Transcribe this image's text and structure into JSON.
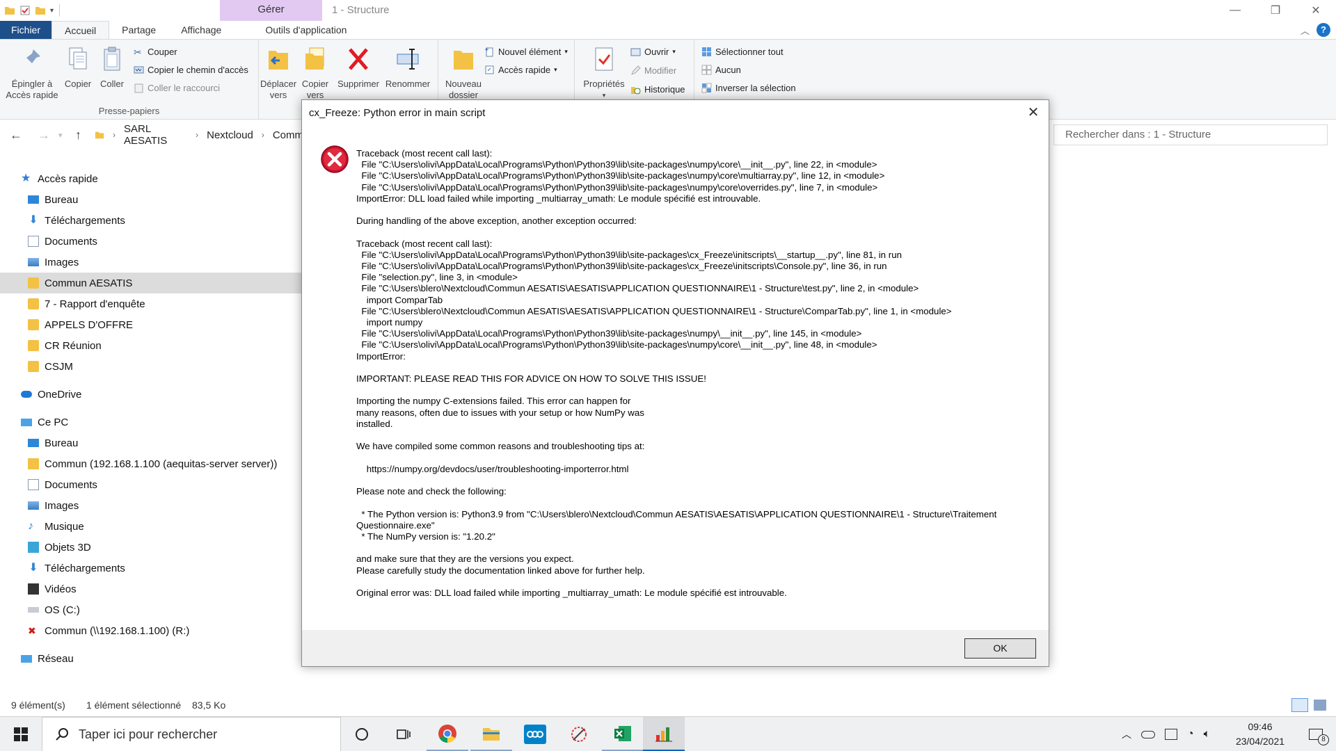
{
  "window": {
    "title": "1 - Structure",
    "context_tab": "Gérer"
  },
  "ribbon_tabs": [
    "Fichier",
    "Accueil",
    "Partage",
    "Affichage",
    "Outils d'application"
  ],
  "ribbon": {
    "pin_label": "Épingler à Accès rapide",
    "pin_line1": "Épingler à",
    "pin_line2": "Accès rapide",
    "copy": "Copier",
    "paste": "Coller",
    "cut": "Couper",
    "copy_path": "Copier le chemin d'accès",
    "paste_shortcut": "Coller le raccourci",
    "clipboard_group": "Presse-papiers",
    "move_line1": "Déplacer",
    "move_line2": "vers",
    "copyto_line1": "Copier",
    "copyto_line2": "vers",
    "delete": "Supprimer",
    "rename": "Renommer",
    "newfolder_line1": "Nouveau",
    "newfolder_line2": "dossier",
    "new_item": "Nouvel élément",
    "quick_access": "Accès rapide",
    "properties": "Propriétés",
    "open": "Ouvrir",
    "edit": "Modifier",
    "history": "Historique",
    "select_all": "Sélectionner tout",
    "select_none": "Aucun",
    "invert": "Inverser la sélection"
  },
  "address": {
    "crumbs": [
      "SARL AESATIS",
      "Nextcloud",
      "Comm"
    ],
    "search_placeholder": "Rechercher dans : 1 - Structure"
  },
  "nav": {
    "quick_access": "Accès rapide",
    "qa_items": [
      "Bureau",
      "Téléchargements",
      "Documents",
      "Images",
      "Commun AESATIS",
      "7 - Rapport d'enquête",
      "APPELS D'OFFRE",
      "CR Réunion",
      "CSJM"
    ],
    "onedrive": "OneDrive",
    "this_pc": "Ce PC",
    "pc_items": [
      "Bureau",
      "Commun (192.168.1.100 (aequitas-server server))",
      "Documents",
      "Images",
      "Musique",
      "Objets 3D",
      "Téléchargements",
      "Vidéos",
      "OS (C:)",
      "Commun (\\\\192.168.1.100) (R:)"
    ],
    "network": "Réseau"
  },
  "status": {
    "count": "9 élément(s)",
    "selected": "1 élément sélectionné",
    "size": "83,5 Ko"
  },
  "dialog": {
    "title": "cx_Freeze: Python error in main script",
    "message": "Traceback (most recent call last):\n  File \"C:\\Users\\olivi\\AppData\\Local\\Programs\\Python\\Python39\\lib\\site-packages\\numpy\\core\\__init__.py\", line 22, in <module>\n  File \"C:\\Users\\olivi\\AppData\\Local\\Programs\\Python\\Python39\\lib\\site-packages\\numpy\\core\\multiarray.py\", line 12, in <module>\n  File \"C:\\Users\\olivi\\AppData\\Local\\Programs\\Python\\Python39\\lib\\site-packages\\numpy\\core\\overrides.py\", line 7, in <module>\nImportError: DLL load failed while importing _multiarray_umath: Le module spécifié est introuvable.\n\nDuring handling of the above exception, another exception occurred:\n\nTraceback (most recent call last):\n  File \"C:\\Users\\olivi\\AppData\\Local\\Programs\\Python\\Python39\\lib\\site-packages\\cx_Freeze\\initscripts\\__startup__.py\", line 81, in run\n  File \"C:\\Users\\olivi\\AppData\\Local\\Programs\\Python\\Python39\\lib\\site-packages\\cx_Freeze\\initscripts\\Console.py\", line 36, in run\n  File \"selection.py\", line 3, in <module>\n  File \"C:\\Users\\blero\\Nextcloud\\Commun AESATIS\\AESATIS\\APPLICATION QUESTIONNAIRE\\1 - Structure\\test.py\", line 2, in <module>\n    import ComparTab\n  File \"C:\\Users\\blero\\Nextcloud\\Commun AESATIS\\AESATIS\\APPLICATION QUESTIONNAIRE\\1 - Structure\\ComparTab.py\", line 1, in <module>\n    import numpy\n  File \"C:\\Users\\olivi\\AppData\\Local\\Programs\\Python\\Python39\\lib\\site-packages\\numpy\\__init__.py\", line 145, in <module>\n  File \"C:\\Users\\olivi\\AppData\\Local\\Programs\\Python\\Python39\\lib\\site-packages\\numpy\\core\\__init__.py\", line 48, in <module>\nImportError:\n\nIMPORTANT: PLEASE READ THIS FOR ADVICE ON HOW TO SOLVE THIS ISSUE!\n\nImporting the numpy C-extensions failed. This error can happen for\nmany reasons, often due to issues with your setup or how NumPy was\ninstalled.\n\nWe have compiled some common reasons and troubleshooting tips at:\n\n    https://numpy.org/devdocs/user/troubleshooting-importerror.html\n\nPlease note and check the following:\n\n  * The Python version is: Python3.9 from \"C:\\Users\\blero\\Nextcloud\\Commun AESATIS\\AESATIS\\APPLICATION QUESTIONNAIRE\\1 - Structure\\Traitement\nQuestionnaire.exe\"\n  * The NumPy version is: \"1.20.2\"\n\nand make sure that they are the versions you expect.\nPlease carefully study the documentation linked above for further help.\n\nOriginal error was: DLL load failed while importing _multiarray_umath: Le module spécifié est introuvable.",
    "ok": "OK"
  },
  "taskbar": {
    "search_placeholder": "Taper ici pour rechercher",
    "time": "09:46",
    "date": "23/04/2021",
    "notif_count": "8"
  },
  "colors": {
    "file_tab": "#1d4f8a",
    "context_tab": "#e2c9f2",
    "error_red": "#c8102e",
    "accent": "#0a64b8"
  }
}
